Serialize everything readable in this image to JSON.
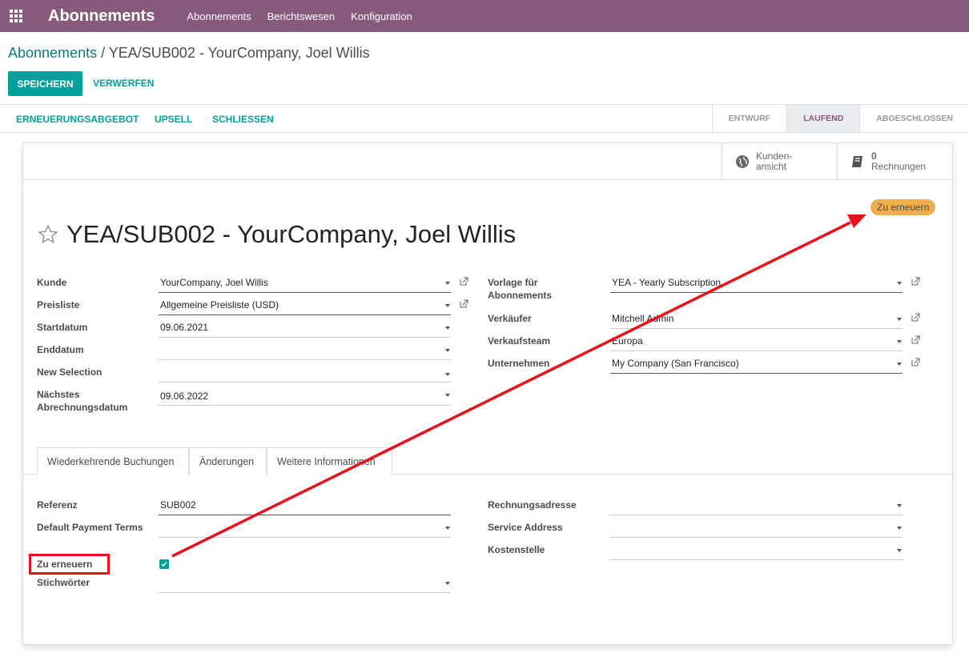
{
  "navbar": {
    "app_title": "Abonnements",
    "menu": [
      "Abonnements",
      "Berichtswesen",
      "Konfiguration"
    ]
  },
  "breadcrumb": {
    "parent": "Abonnements",
    "separator": " / ",
    "current": "YEA/SUB002 - YourCompany, Joel Willis"
  },
  "actions": {
    "save": "SPEICHERN",
    "discard": "VERWERFEN"
  },
  "statusbar": {
    "buttons": [
      "ERNEUERUNGSABGEBOT",
      "UPSELL",
      "SCHLIESSEN"
    ],
    "stages": [
      "ENTWURF",
      "LAUFEND",
      "ABGESCHLOSSEN"
    ],
    "active_stage": "LAUFEND"
  },
  "stat_buttons": {
    "customer_view": {
      "line1": "Kunden-",
      "line2": "ansicht",
      "icon": "globe-icon"
    },
    "invoices": {
      "count": "0",
      "label": "Rechnungen",
      "icon": "book-icon"
    }
  },
  "badge": "Zu erneuern",
  "title": "YEA/SUB002 - YourCompany, Joel Willis",
  "left_fields": [
    {
      "label": "Kunde",
      "value": "YourCompany, Joel Willis"
    },
    {
      "label": "Preisliste",
      "value": "Allgemeine Preisliste (USD)"
    },
    {
      "label": "Startdatum",
      "value": "09.06.2021"
    },
    {
      "label": "Enddatum",
      "value": ""
    },
    {
      "label": "New Selection",
      "value": ""
    },
    {
      "label": "Nächstes Abrechnungsdatum",
      "value": "09.06.2022"
    }
  ],
  "right_fields": [
    {
      "label": "Vorlage für Abonnements",
      "value": "YEA - Yearly Subscription"
    },
    {
      "label": "Verkäufer",
      "value": "Mitchell Admin"
    },
    {
      "label": "Verkaufsteam",
      "value": "Europa"
    },
    {
      "label": "Unternehmen",
      "value": "My Company (San Francisco)"
    }
  ],
  "tabs": [
    "Wiederkehrende Buchungen",
    "Änderungen",
    "Weitere Informationen"
  ],
  "active_tab": "Weitere Informationen",
  "info_left": [
    {
      "label": "Referenz",
      "value": "SUB002"
    },
    {
      "label": "Default Payment Terms",
      "value": ""
    },
    {
      "label": "Zu erneuern",
      "value": true
    },
    {
      "label": "Stichwörter",
      "value": ""
    }
  ],
  "info_right": [
    {
      "label": "Rechnungsadresse",
      "value": ""
    },
    {
      "label": "Service Address",
      "value": ""
    },
    {
      "label": "Kostenstelle",
      "value": ""
    }
  ],
  "colors": {
    "navbar": "#875a7b",
    "primary": "#00a09d",
    "badge": "#f0ad4e",
    "annotation": "#e8131a"
  }
}
